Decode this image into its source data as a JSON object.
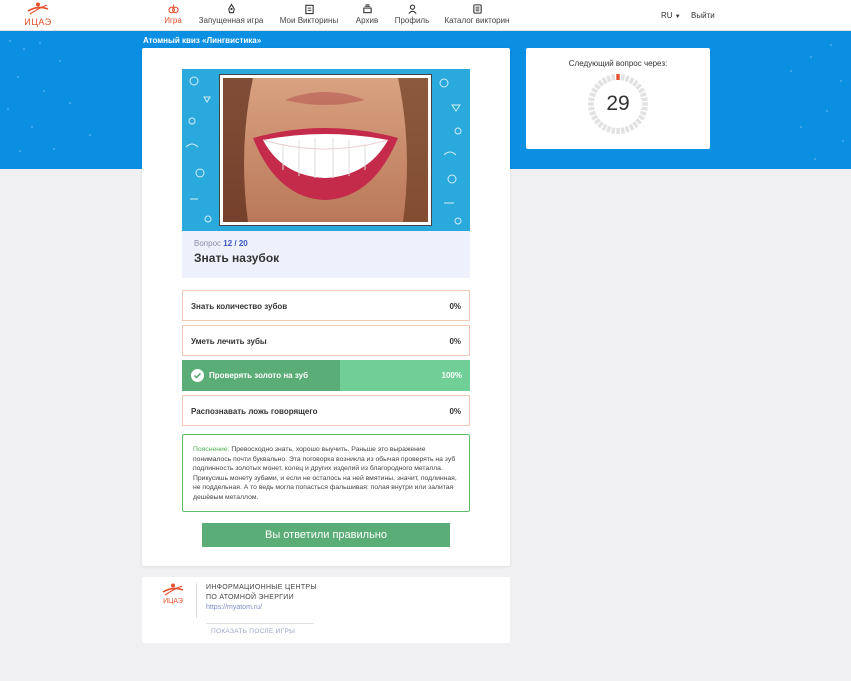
{
  "brand": {
    "logo_text": "ИЦАЭ",
    "accent": "#e6512b",
    "banner_color": "#0a8fe3"
  },
  "nav": {
    "items": [
      {
        "label": "Игра",
        "icon": "gamepad-icon",
        "active": true
      },
      {
        "label": "Запущенная игра",
        "icon": "rocket-icon"
      },
      {
        "label": "Мои Викторины",
        "icon": "quizzes-icon"
      },
      {
        "label": "Архив",
        "icon": "archive-icon"
      },
      {
        "label": "Профиль",
        "icon": "profile-icon"
      },
      {
        "label": "Каталог викторин",
        "icon": "catalog-icon"
      }
    ],
    "language": "RU",
    "logout": "Выйти"
  },
  "quiz": {
    "title": "Атомный квиз «Лингвистика»",
    "question_prefix": "Вопрос",
    "question_number": "12 / 20",
    "question_text": "Знать назубок",
    "answers": [
      {
        "label": "Знать количество зубов",
        "percent": "0%"
      },
      {
        "label": "Уметь лечить зубы",
        "percent": "0%"
      },
      {
        "label": "Проверять золото на зуб",
        "percent": "100%",
        "correct": true,
        "fill": 0.55
      },
      {
        "label": "Распознавать ложь говорящего",
        "percent": "0%"
      }
    ],
    "explanation_head": "Пояснение:",
    "explanation_text": "Превосходно знать, хорошо выучить. Раньше это выражение понималось почти буквально. Эта поговорка возникла из обычая проверять на зуб подлинность золотых монет, колец и других изделий из благородного металла. Прикусишь монету зубами, и если не осталось на ней вмятины, значит, подлинная, не поддельная. А то ведь могла попасться фальшивая: полая внутри или залитая дешёвым металлом.",
    "result": "Вы ответили правильно"
  },
  "timer": {
    "label": "Следующий вопрос через:",
    "seconds": "29",
    "progress": 0.03
  },
  "footer": {
    "org_line1": "ИНФОРМАЦИОННЫЕ ЦЕНТРЫ",
    "org_line2": "ПО АТОМНОЙ ЭНЕРГИИ",
    "url": "https://myatom.ru/",
    "show_after": "ПОКАЗАТЬ ПОСЛЕ ИГРЫ"
  }
}
